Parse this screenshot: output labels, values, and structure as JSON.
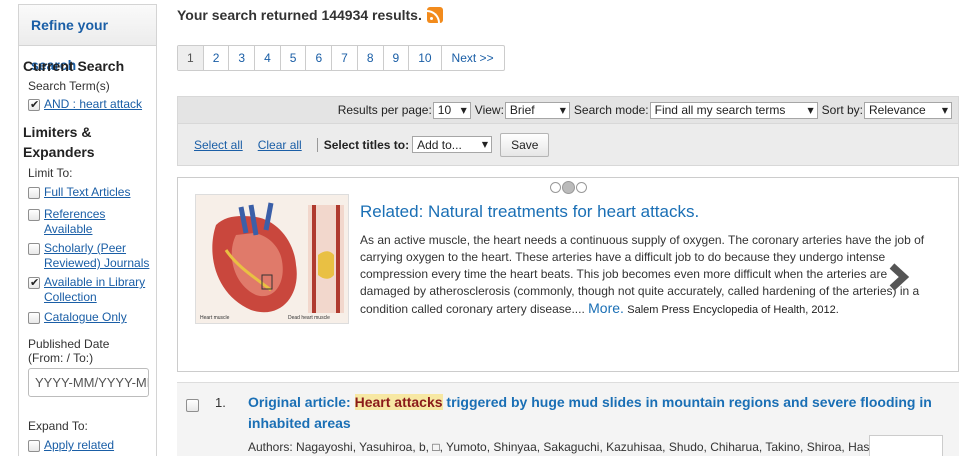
{
  "sidebar": {
    "header": "Refine your search",
    "current_search": {
      "heading": "Current Search",
      "label": "Search Term(s)",
      "term": "AND : heart attack"
    },
    "limiters": {
      "heading": "Limiters & Expanders",
      "limit_to": "Limit To:",
      "items": [
        {
          "label": "Full Text Articles",
          "checked": false
        },
        {
          "label": "References Available",
          "checked": false
        },
        {
          "label": "Scholarly (Peer Reviewed) Journals",
          "checked": false
        },
        {
          "label": "Available in Library Collection",
          "checked": true
        },
        {
          "label": "Catalogue Only",
          "checked": false
        }
      ],
      "date_label": "Published Date (From: / To:)",
      "date_placeholder": "YYYY-MM/YYYY-MM"
    },
    "expand": {
      "heading": "Expand To:",
      "items": [
        {
          "label": "Apply related"
        }
      ]
    }
  },
  "main": {
    "results_text": "Your search returned 144934 results.",
    "pagination": [
      "1",
      "2",
      "3",
      "4",
      "5",
      "6",
      "7",
      "8",
      "9",
      "10",
      "Next >>"
    ],
    "toolbar": {
      "per_page_label": "Results per page:",
      "per_page_value": "10",
      "view_label": "View:",
      "view_value": "Brief",
      "mode_label": "Search mode:",
      "mode_value": "Find all my search terms",
      "sort_label": "Sort by:",
      "sort_value": "Relevance"
    },
    "actions": {
      "select_all": "Select all",
      "clear_all": "Clear all",
      "select_titles_label": "Select titles to:",
      "add_to": "Add to...",
      "save": "Save"
    },
    "related": {
      "title": "Related: Natural treatments for heart attacks.",
      "body": "As an active muscle, the heart needs a continuous supply of oxygen. The coronary arteries have the job of carrying oxygen to the heart. These arteries have a difficult job to do because they undergo intense compression every time the heart beats. This job becomes even more difficult when the arteries are damaged by atherosclerosis (commonly, though not quite accurately, called hardening of the arteries) in a condition called coronary artery disease....",
      "more": "More.",
      "source": "Salem Press Encyclopedia of Health, 2012."
    },
    "results": [
      {
        "number": "1.",
        "title_prefix": "Original article: ",
        "title_highlight": "Heart attacks",
        "title_rest": " triggered by huge mud slides in mountain regions and severe flooding in inhabited areas",
        "authors": "Authors: Nagayoshi, Yasuhiroa, b, □, Yumoto, Shinyaa, Sakaguchi, Kazuhisaa, Shudo, Chiharua, Takino, Shiroa, Hashiyama,"
      }
    ]
  }
}
